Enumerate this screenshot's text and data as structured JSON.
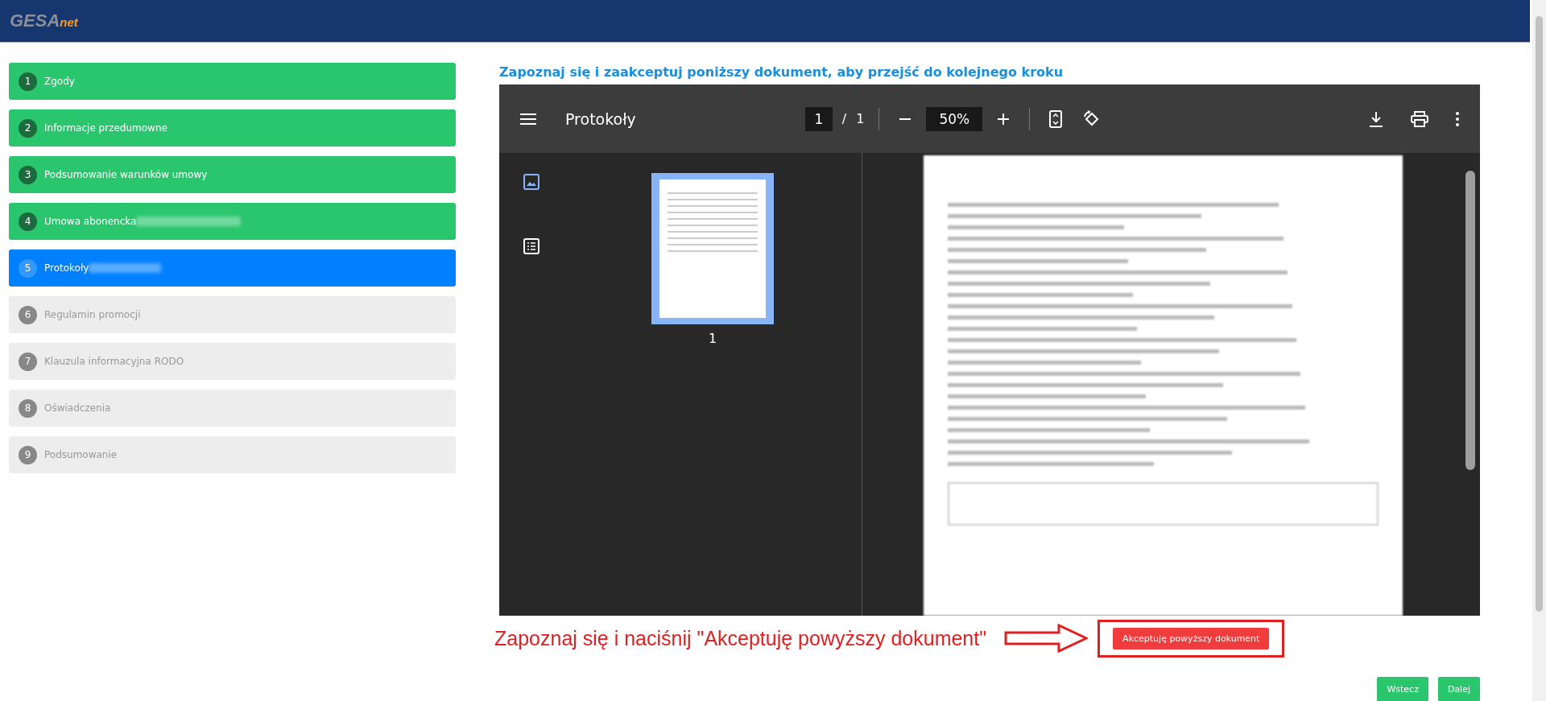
{
  "header": {
    "logo_main": "GESA",
    "logo_suffix": "net"
  },
  "steps": [
    {
      "number": "1",
      "label": "Zgody",
      "completed": true,
      "selected": false,
      "redacted": false
    },
    {
      "number": "2",
      "label": "Informacje przedumowne",
      "completed": true,
      "selected": false,
      "redacted": false
    },
    {
      "number": "3",
      "label": "Podsumowanie warunków umowy",
      "completed": true,
      "selected": false,
      "redacted": false
    },
    {
      "number": "4",
      "label": "Umowa abonencka",
      "completed": true,
      "selected": false,
      "redacted": true
    },
    {
      "number": "5",
      "label": "Protokoły",
      "completed": false,
      "selected": true,
      "redacted": true
    },
    {
      "number": "6",
      "label": "Regulamin promocji",
      "completed": false,
      "selected": false,
      "redacted": false
    },
    {
      "number": "7",
      "label": "Klauzula informacyjna RODO",
      "completed": false,
      "selected": false,
      "redacted": false
    },
    {
      "number": "8",
      "label": "Oświadczenia",
      "completed": false,
      "selected": false,
      "redacted": false
    },
    {
      "number": "9",
      "label": "Podsumowanie",
      "completed": false,
      "selected": false,
      "redacted": false
    }
  ],
  "instruction": "Zapoznaj się i zaakceptuj poniższy dokument, aby przejść do kolejnego kroku",
  "viewer": {
    "title": "Protokoły",
    "page": "1",
    "separator": "/",
    "page_count": "1",
    "zoom": "50%",
    "thumbnails": [
      {
        "label": "1",
        "selected": true
      }
    ]
  },
  "annotation": "Zapoznaj się i naciśnij \"Akceptuję powyższy dokument\"",
  "accept_button": "Akceptuję powyższy dokument",
  "nav_buttons": [
    "Wstecz",
    "Dalej"
  ]
}
